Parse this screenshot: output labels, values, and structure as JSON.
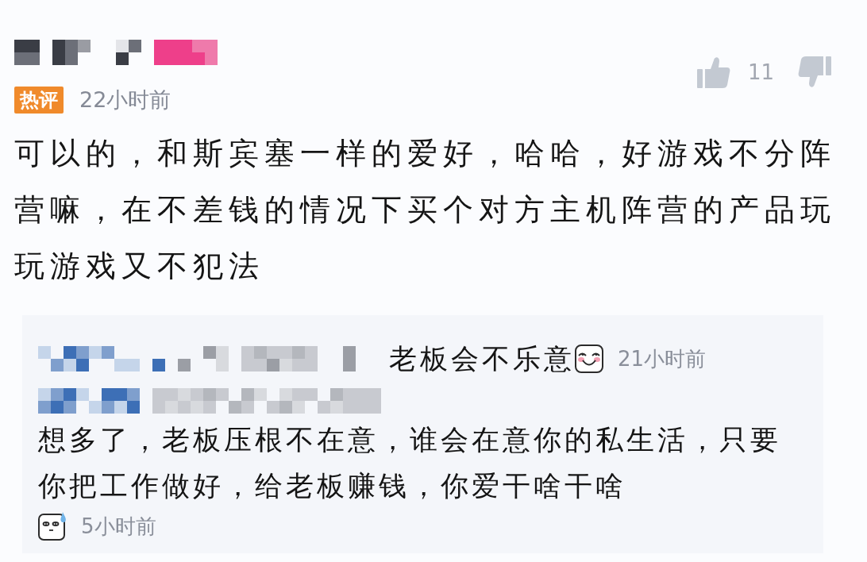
{
  "comment": {
    "badge": "热评",
    "time": "22小时前",
    "likes": "11",
    "text": "可以的，和斯宾塞一样的爱好，哈哈，好游戏不分阵营嘛，在不差钱的情况下买个对方主机阵营的产品玩玩游戏又不犯法"
  },
  "replies": [
    {
      "kind": "smile",
      "text": "老板会不乐意",
      "time": "21小时前"
    },
    {
      "kind": "sweat",
      "text": "想多了，老板压根不在意，谁会在意你的私生活，只要你把工作做好，给老板赚钱，你爱干啥干啥",
      "time": "5小时前"
    }
  ]
}
